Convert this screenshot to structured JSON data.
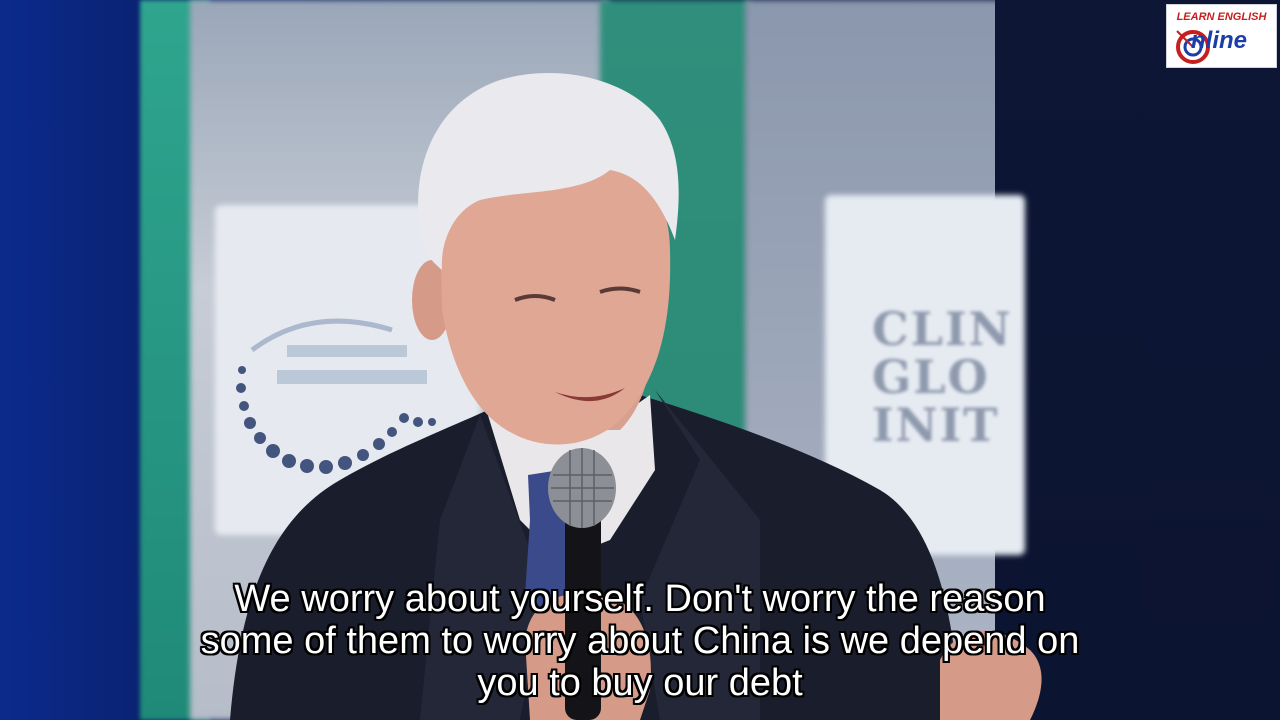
{
  "scene": {
    "background_colors": {
      "teal": "#2a8a74",
      "navy": "#0b1a44",
      "blue": "#0b2a8c"
    },
    "stage_banner_text": [
      "CLIN",
      "GLO",
      "INIT"
    ]
  },
  "watermark": {
    "line1": "LEARN ENGLISH",
    "line2": "nline",
    "icon": "target-o-icon"
  },
  "subtitles": {
    "lines": [
      "We worry about yourself. Don't worry the reason",
      "some of them to worry about China is we depend on",
      "you to buy our debt"
    ]
  }
}
